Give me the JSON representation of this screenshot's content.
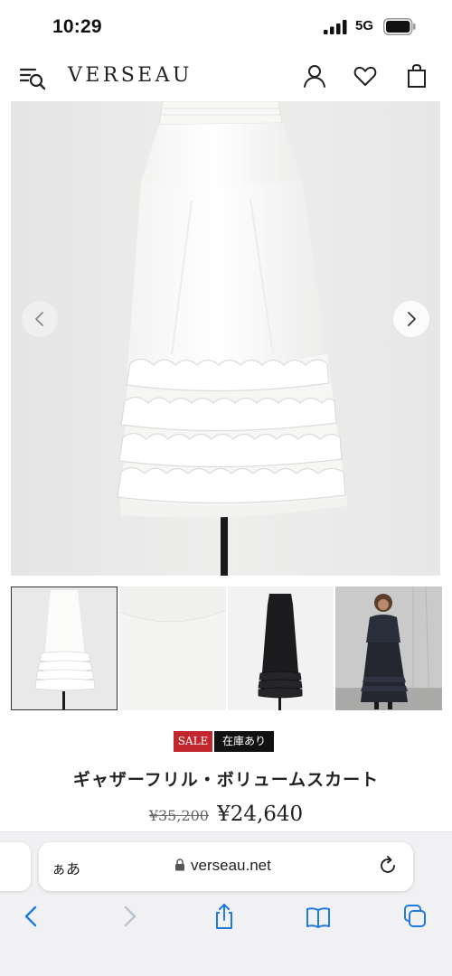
{
  "status_bar": {
    "time": "10:29",
    "network": "5G"
  },
  "header": {
    "brand": "VERSEAU",
    "icons": [
      "menu-search-icon",
      "user-icon",
      "heart-icon",
      "shopping-bag-icon"
    ]
  },
  "gallery": {
    "main_image": "white ruffle tiered maxi skirt on mannequin",
    "thumbnails": [
      "white skirt full view",
      "white skirt waist detail",
      "black skirt on mannequin",
      "model wearing black skirt"
    ],
    "selected_thumbnail": 1
  },
  "product": {
    "badge_sale": "SALE",
    "badge_stock": "在庫あり",
    "name": "ギャザーフリル・ボリュームスカート",
    "price_original": "¥35,200",
    "price_sale": "¥24,640"
  },
  "browser": {
    "aa_label": "ぁあ",
    "url": "verseau.net"
  },
  "colors": {
    "sale_badge": "#c1272d",
    "stock_badge": "#111111",
    "link_blue": "#1f7ae0"
  }
}
